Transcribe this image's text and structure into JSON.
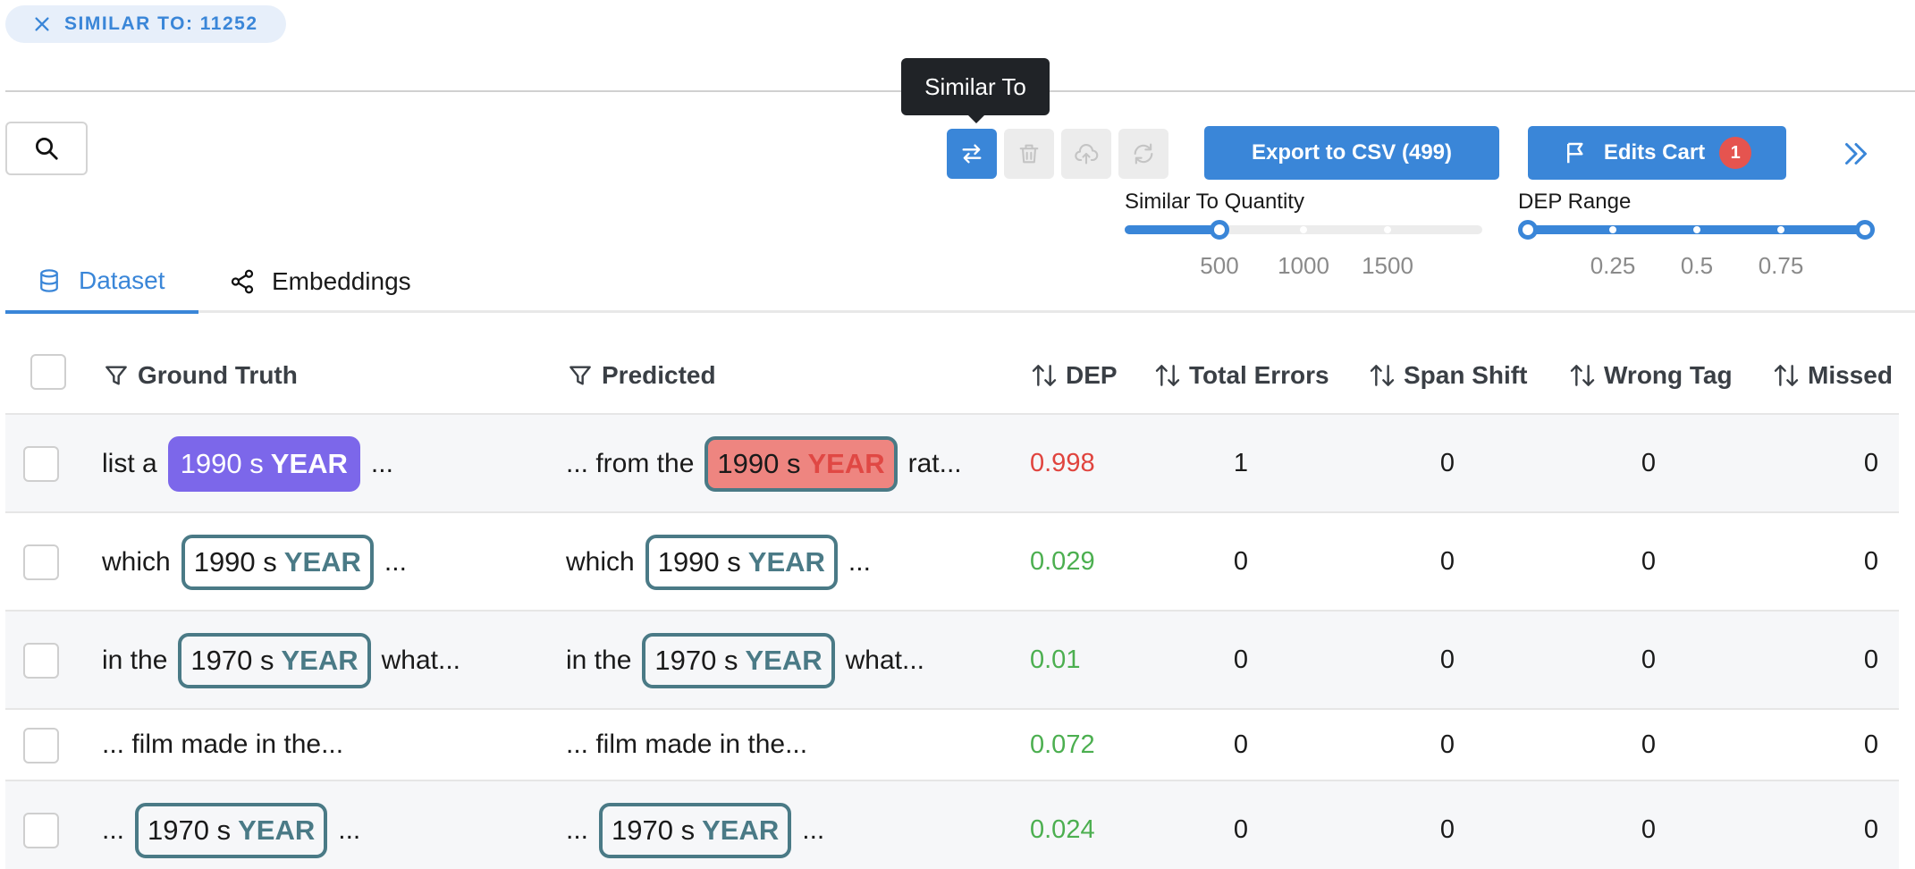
{
  "filter_chip": {
    "label": "SIMILAR TO: 11252"
  },
  "tooltip": {
    "text": "Similar To"
  },
  "toolbar": {
    "similar_to_icon": "swap-arrows-icon",
    "delete_icon": "trash-icon",
    "upload_icon": "cloud-upload-icon",
    "reset_icon": "refresh-icon",
    "export_label": "Export to CSV (499)",
    "edits_cart_label": "Edits Cart",
    "edits_cart_count": "1",
    "collapse_icon": "chevrons-right-icon"
  },
  "similar_slider": {
    "label": "Similar To Quantity",
    "marks": [
      "500",
      "1000",
      "1500"
    ],
    "value": 500
  },
  "dep_slider": {
    "label": "DEP Range",
    "marks": [
      "0.25",
      "0.5",
      "0.75"
    ],
    "range": [
      0,
      1
    ]
  },
  "tabs": [
    {
      "label": "Dataset",
      "icon": "database-icon",
      "active": true
    },
    {
      "label": "Embeddings",
      "icon": "share-nodes-icon",
      "active": false
    }
  ],
  "columns": {
    "ground_truth": "Ground Truth",
    "predicted": "Predicted",
    "dep": "DEP",
    "total_errors": "Total Errors",
    "span_shift": "Span Shift",
    "wrong_tag": "Wrong Tag",
    "missed": "Missed"
  },
  "rows": [
    {
      "gt": {
        "pre": "list a",
        "span": "1990 s",
        "tag": "YEAR",
        "post": "..."
      },
      "pred": {
        "pre": "... from the",
        "span": "1990 s",
        "tag": "YEAR",
        "post": "rat..."
      },
      "dep": "0.998",
      "total_errors": "1",
      "span_shift": "0",
      "wrong_tag": "0",
      "missed": "0"
    },
    {
      "gt": {
        "pre": "which",
        "span": "1990 s",
        "tag": "YEAR",
        "post": "..."
      },
      "pred": {
        "pre": "which",
        "span": "1990 s",
        "tag": "YEAR",
        "post": "..."
      },
      "dep": "0.029",
      "total_errors": "0",
      "span_shift": "0",
      "wrong_tag": "0",
      "missed": "0"
    },
    {
      "gt": {
        "pre": "in the",
        "span": "1970 s",
        "tag": "YEAR",
        "post": "what..."
      },
      "pred": {
        "pre": "in the",
        "span": "1970 s",
        "tag": "YEAR",
        "post": "what..."
      },
      "dep": "0.01",
      "total_errors": "0",
      "span_shift": "0",
      "wrong_tag": "0",
      "missed": "0"
    },
    {
      "gt": {
        "pre": "... film made in the..."
      },
      "pred": {
        "pre": "... film made in the..."
      },
      "dep": "0.072",
      "total_errors": "0",
      "span_shift": "0",
      "wrong_tag": "0",
      "missed": "0"
    },
    {
      "gt": {
        "pre": "...",
        "span": "1970 s",
        "tag": "YEAR",
        "post": "..."
      },
      "pred": {
        "pre": "...",
        "span": "1970 s",
        "tag": "YEAR",
        "post": "..."
      },
      "dep": "0.024",
      "total_errors": "0",
      "span_shift": "0",
      "wrong_tag": "0",
      "missed": "0"
    }
  ],
  "colors": {
    "accent": "#3a86d8",
    "dep_high": "#e0443e",
    "dep_low": "#4caf50",
    "gt_highlight": "#7c67ea",
    "pred_error": "#ee8580"
  }
}
